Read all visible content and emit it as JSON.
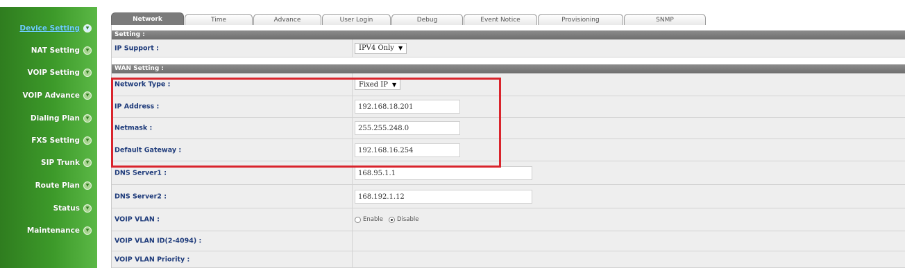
{
  "sidebar": {
    "items": [
      {
        "label": "Device Setting",
        "active": true
      },
      {
        "label": "NAT Setting",
        "active": false
      },
      {
        "label": "VOIP Setting",
        "active": false
      },
      {
        "label": "VOIP Advance",
        "active": false
      },
      {
        "label": "Dialing Plan",
        "active": false
      },
      {
        "label": "FXS Setting",
        "active": false
      },
      {
        "label": "SIP Trunk",
        "active": false
      },
      {
        "label": "Route Plan",
        "active": false
      },
      {
        "label": "Status",
        "active": false
      },
      {
        "label": "Maintenance",
        "active": false
      }
    ]
  },
  "tabs": [
    {
      "label": "Network",
      "active": true
    },
    {
      "label": "Time",
      "active": false
    },
    {
      "label": "Advance",
      "active": false
    },
    {
      "label": "User Login",
      "active": false
    },
    {
      "label": "Debug",
      "active": false
    },
    {
      "label": "Event Notice",
      "active": false
    },
    {
      "label": "Provisioning",
      "active": false
    },
    {
      "label": "SNMP",
      "active": false
    }
  ],
  "setting": {
    "header": "Setting :",
    "ip_support_label": "IP Support :",
    "ip_support_value": "IPV4 Only"
  },
  "wan": {
    "header": "WAN Setting :",
    "network_type_label": "Network Type :",
    "network_type_value": "Fixed IP",
    "ip_address_label": "IP Address :",
    "ip_address_value": "192.168.18.201",
    "netmask_label": "Netmask :",
    "netmask_value": "255.255.248.0",
    "gateway_label": "Default Gateway :",
    "gateway_value": "192.168.16.254",
    "dns1_label": "DNS Server1 :",
    "dns1_value": "168.95.1.1",
    "dns2_label": "DNS Server2 :",
    "dns2_value": "168.192.1.12",
    "voip_vlan_label": "VOIP VLAN :",
    "voip_vlan_enable": "Enable",
    "voip_vlan_disable": "Disable",
    "voip_vlan_selected": "Disable",
    "voip_vlan_id_label": "VOIP VLAN ID(2-4094) :",
    "voip_vlan_priority_label": "VOIP VLAN Priority :"
  },
  "colors": {
    "sidebar_green": "#3d9a2a",
    "header_gray": "#7b7b7b",
    "label_blue": "#1d3a7a",
    "highlight_red": "#d9242c"
  }
}
